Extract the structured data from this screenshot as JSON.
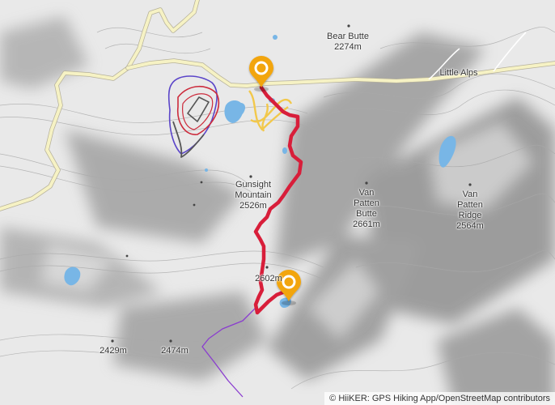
{
  "map": {
    "labels": {
      "bear_butte": {
        "name": "Bear Butte",
        "elevation": "2274m"
      },
      "little_alps": {
        "name": "Little Alps"
      },
      "gunsight_mountain": {
        "name": "Gunsight Mountain",
        "elevation": "2526m"
      },
      "van_patten_butte": {
        "name": "Van Patten Butte",
        "elevation": "2661m"
      },
      "van_patten_ridge": {
        "name": "Van Patten Ridge",
        "elevation": "2564m"
      },
      "peak_2602": {
        "elevation": "2602m"
      },
      "peak_2429": {
        "elevation": "2429m"
      },
      "peak_2474": {
        "elevation": "2474m"
      }
    },
    "route": {
      "color": "#d81e3a"
    },
    "markers": [
      {
        "name": "start",
        "icon": "map-pin-icon"
      },
      {
        "name": "end",
        "icon": "map-pin-icon"
      }
    ],
    "colors": {
      "marker": "#f2a511",
      "road": "#f6f2c4",
      "water": "#78b6e6",
      "trail_purple": "#8a3ccf",
      "trail_yellow": "#f2c84b"
    },
    "attribution": "© HiiKER: GPS Hiking App/OpenStreetMap contributors"
  }
}
